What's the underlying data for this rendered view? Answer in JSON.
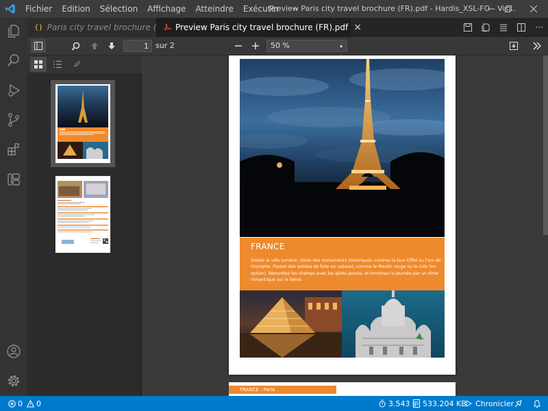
{
  "menu": {
    "items": [
      "Fichier",
      "Edition",
      "Sélection",
      "Affichage",
      "Atteindre",
      "Exécuter"
    ],
    "more": "···"
  },
  "window": {
    "title": "Preview Paris city travel brochure (FR).pdf - Hardis_XSL-FO - Vis..."
  },
  "tabs": [
    {
      "label": "Paris city travel brochure (FR)",
      "icon": "braces-icon",
      "active": false
    },
    {
      "label": "Preview Paris city travel brochure (FR).pdf",
      "icon": "pdf-icon",
      "active": true,
      "close": "×"
    }
  ],
  "toolbar": {
    "page_current": "1",
    "page_total_label": "sur 2",
    "zoom": "50 %"
  },
  "document": {
    "page1": {
      "heading": "FRANCE",
      "body": "Visitez la ville lumière. Visite des monuments historiques, comme la tour Eiffel ou l'arc de triomphe. Passez des soirées de folie en cabaret, comme le Moulin rouge ou le Lido (en option). Remontez les champs avec les gilets jaunes, et terminez la journée par un diner romantique sur la Seine."
    },
    "page2": {
      "band": "FRANCE : Paris"
    }
  },
  "status": {
    "errors": "0",
    "warnings": "0",
    "time": "3.543 s",
    "memory": "533.204 KB",
    "action": "Chronicler"
  },
  "colors": {
    "accent": "#007acc",
    "brochure_orange": "#ee8a2e",
    "vscode_logo": "#3c99d4",
    "pdf_icon": "#e04040"
  }
}
